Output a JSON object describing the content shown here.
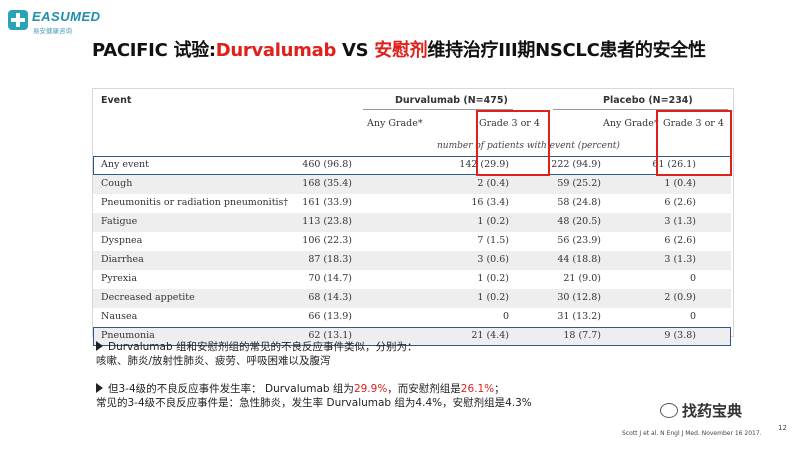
{
  "logo": {
    "brand": "EASUMED",
    "tagline": "易安健康咨询"
  },
  "title": {
    "part1": "PACIFIC 试验:",
    "part2": "Durvalumab",
    "part3": " VS ",
    "part4": "安慰剂",
    "part5": "维持治疗III期NSCLC患者的安全性"
  },
  "table": {
    "event_header": "Event",
    "group1": "Durvalumab (N=475)",
    "group2": "Placebo (N=234)",
    "any_grade": "Any Grade*",
    "grade34": "Grade 3 or 4",
    "unit_note": "number of patients with event (percent)",
    "rows": [
      {
        "event": "Any event",
        "d_any": "460 (96.8)",
        "d_g34": "142 (29.9)",
        "p_any": "222 (94.9)",
        "p_g34": "61 (26.1)"
      },
      {
        "event": "Cough",
        "d_any": "168 (35.4)",
        "d_g34": "2 (0.4)",
        "p_any": "59 (25.2)",
        "p_g34": "1 (0.4)"
      },
      {
        "event": "Pneumonitis or radiation pneumonitis†",
        "d_any": "161 (33.9)",
        "d_g34": "16 (3.4)",
        "p_any": "58 (24.8)",
        "p_g34": "6 (2.6)"
      },
      {
        "event": "Fatigue",
        "d_any": "113 (23.8)",
        "d_g34": "1 (0.2)",
        "p_any": "48 (20.5)",
        "p_g34": "3 (1.3)"
      },
      {
        "event": "Dyspnea",
        "d_any": "106 (22.3)",
        "d_g34": "7 (1.5)",
        "p_any": "56 (23.9)",
        "p_g34": "6 (2.6)"
      },
      {
        "event": "Diarrhea",
        "d_any": "87 (18.3)",
        "d_g34": "3 (0.6)",
        "p_any": "44 (18.8)",
        "p_g34": "3 (1.3)"
      },
      {
        "event": "Pyrexia",
        "d_any": "70 (14.7)",
        "d_g34": "1 (0.2)",
        "p_any": "21 (9.0)",
        "p_g34": "0"
      },
      {
        "event": "Decreased appetite",
        "d_any": "68 (14.3)",
        "d_g34": "1 (0.2)",
        "p_any": "30 (12.8)",
        "p_g34": "2 (0.9)"
      },
      {
        "event": "Nausea",
        "d_any": "66 (13.9)",
        "d_g34": "0",
        "p_any": "31 (13.2)",
        "p_g34": "0"
      },
      {
        "event": "Pneumonia",
        "d_any": "62 (13.1)",
        "d_g34": "21 (4.4)",
        "p_any": "18 (7.7)",
        "p_g34": "9 (3.8)"
      }
    ]
  },
  "notes": {
    "line1": "Durvalumab 组和安慰剂组的常见的不良反应事件类似，分别为：",
    "line2": "咳嗽、肺炎/放射性肺炎、疲劳、呼吸困难以及腹泻",
    "line3a": "但3-4级的不良反应事件发生率： Durvalumab 组为",
    "line3b": "29.9%",
    "line3c": "，而安慰剂组是",
    "line3d": "26.1%",
    "line3e": "；",
    "line4": "常见的3-4级不良反应事件是：急性肺炎，发生率 Durvalumab 组为4.4%，安慰剂组是4.3%"
  },
  "watermark": "找药宝典",
  "citation": "Scott J et al. N Engl J Med. November 16 2017.",
  "page_number": "12"
}
